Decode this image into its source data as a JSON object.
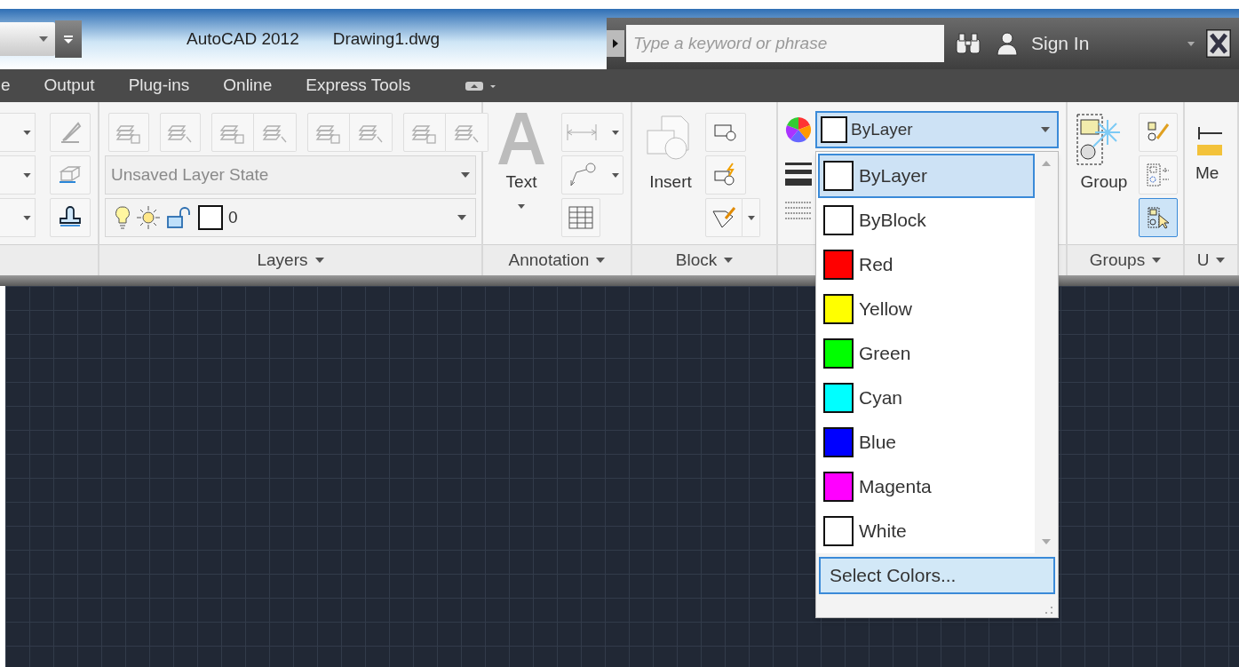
{
  "title_bar": {
    "app": "AutoCAD 2012",
    "document": "Drawing1.dwg",
    "search": {
      "placeholder": "Type a keyword or phrase"
    },
    "sign_in": "Sign In"
  },
  "ribbon_tabs": [
    {
      "label": "e",
      "selected": false
    },
    {
      "label": "Output",
      "selected": false
    },
    {
      "label": "Plug-ins",
      "selected": false
    },
    {
      "label": "Online",
      "selected": false
    },
    {
      "label": "Express Tools",
      "selected": false
    }
  ],
  "layers_panel": {
    "layer_state": "Unsaved Layer State",
    "current_layer": "0",
    "title": "Layers"
  },
  "annotation_panel": {
    "tool": "Text",
    "title": "Annotation"
  },
  "block_panel": {
    "tool": "Insert",
    "title": "Block"
  },
  "properties_panel": {
    "color_value": "ByLayer"
  },
  "groups_panel": {
    "tool": "Group",
    "title": "Groups"
  },
  "utilities_panel": {
    "tool": "Me",
    "title": "U"
  },
  "color_dropdown": {
    "items": [
      {
        "label": "ByLayer",
        "color": "#ffffff",
        "selected": true
      },
      {
        "label": "ByBlock",
        "color": "#ffffff",
        "selected": false
      },
      {
        "label": "Red",
        "color": "#ff0000",
        "selected": false
      },
      {
        "label": "Yellow",
        "color": "#ffff00",
        "selected": false
      },
      {
        "label": "Green",
        "color": "#00ff00",
        "selected": false
      },
      {
        "label": "Cyan",
        "color": "#00ffff",
        "selected": false
      },
      {
        "label": "Blue",
        "color": "#0000ff",
        "selected": false
      },
      {
        "label": "Magenta",
        "color": "#ff00ff",
        "selected": false
      },
      {
        "label": "White",
        "color": "#ffffff",
        "selected": false
      }
    ],
    "footer": "Select Colors..."
  }
}
